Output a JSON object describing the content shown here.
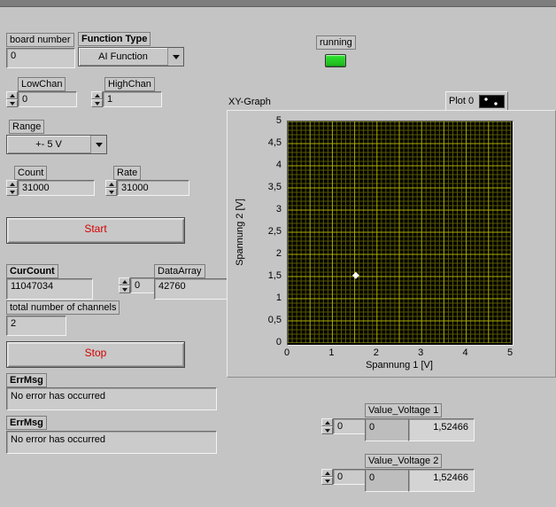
{
  "panel": {
    "board_number": {
      "label": "board number",
      "value": "0"
    },
    "function_type": {
      "label": "Function Type",
      "value": "AI Function"
    },
    "low_chan": {
      "label": "LowChan",
      "value": "0"
    },
    "high_chan": {
      "label": "HighChan",
      "value": "1"
    },
    "range": {
      "label": "Range",
      "value": "+- 5 V"
    },
    "count": {
      "label": "Count",
      "value": "31000"
    },
    "rate": {
      "label": "Rate",
      "value": "31000"
    },
    "start_button_label": "Start",
    "stop_button_label": "Stop",
    "cur_count": {
      "label": "CurCount",
      "value": "11047034"
    },
    "data_array": {
      "label": "DataArray",
      "index": "0",
      "value": "42760"
    },
    "total_channels": {
      "label": "total number of channels",
      "value": "2"
    },
    "err_msg_1": {
      "label": "ErrMsg",
      "value": "No error has occurred"
    },
    "err_msg_2": {
      "label": "ErrMsg",
      "value": "No error has occurred"
    },
    "running": {
      "label": "running",
      "state": "on",
      "color": "#2ee52e"
    },
    "value_voltage_1": {
      "label": "Value_Voltage 1",
      "index": "0",
      "raw": "0",
      "value": "1,52466"
    },
    "value_voltage_2": {
      "label": "Value_Voltage 2",
      "index": "0",
      "raw": "0",
      "value": "1,52466"
    }
  },
  "graph": {
    "label": "XY-Graph",
    "legend": "Plot 0"
  },
  "colors": {
    "button_text": "#d40000",
    "panel_background": "#c4c4c4"
  },
  "chart_data": {
    "type": "scatter",
    "title": "XY-Graph",
    "xlabel": "Spannung 1 [V]",
    "ylabel": "Spannung 2 [V]",
    "xlim": [
      0,
      5
    ],
    "ylim": [
      0,
      5
    ],
    "x_ticks": [
      "0",
      "1",
      "2",
      "3",
      "4",
      "5"
    ],
    "y_ticks": [
      "0",
      "0,5",
      "1",
      "1,5",
      "2",
      "2,5",
      "3",
      "3,5",
      "4",
      "4,5",
      "5"
    ],
    "grid": true,
    "grid_minor_step": 0.1,
    "grid_major_step": 0.5,
    "plot_bg": "#000000",
    "grid_minor_color": "#5a5a00",
    "grid_major_color": "#b0b000",
    "legend_position": "top-right",
    "series": [
      {
        "name": "Plot 0",
        "marker": "diamond",
        "color": "#ffffff",
        "points": [
          [
            1.52466,
            1.52466
          ]
        ]
      }
    ]
  }
}
